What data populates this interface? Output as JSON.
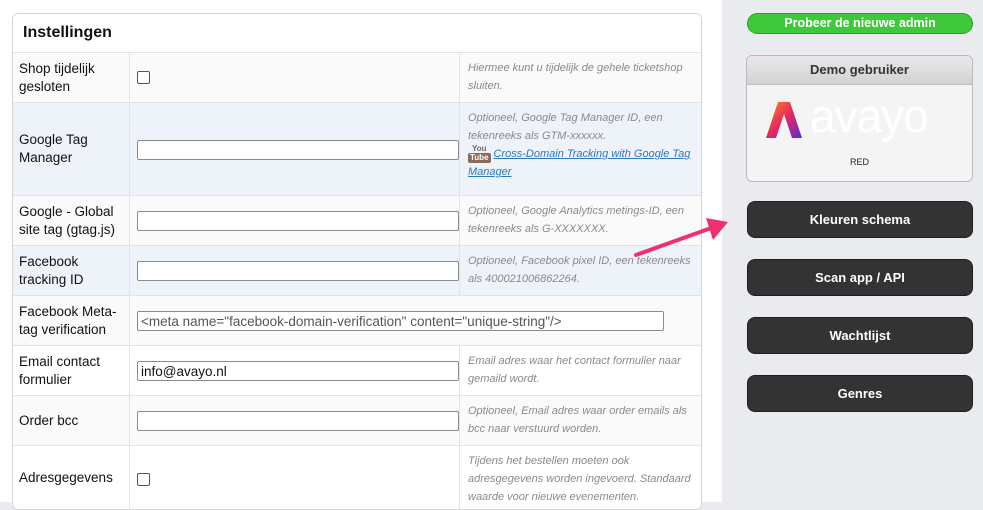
{
  "panel": {
    "title": "Instellingen",
    "rows": [
      {
        "label": "Shop tijdelijk gesloten",
        "type": "checkbox",
        "checked": false,
        "help": "Hiermee kunt u tijdelijk de gehele ticketshop sluiten."
      },
      {
        "label": "Google Tag Manager",
        "type": "text",
        "value": "",
        "placeholder": "",
        "help": "Optioneel, Google Tag Manager ID, een tekenreeks als GTM-xxxxxx.",
        "help_link": "Cross-Domain Tracking with Google Tag Manager",
        "help_icon": {
          "top": "You",
          "bottom": "Tube"
        }
      },
      {
        "label": "Google - Global site tag (gtag.js)",
        "type": "text",
        "value": "",
        "placeholder": "",
        "help": "Optioneel, Google Analytics metings-ID, een tekenreeks als G-XXXXXXX."
      },
      {
        "label": "Facebook tracking ID",
        "type": "text",
        "value": "",
        "placeholder": "",
        "help": "Optioneel, Facebook pixel ID, een tekenreeks als 400021006862264."
      },
      {
        "label": "Facebook Meta-tag verification",
        "type": "text-wide",
        "value": "",
        "placeholder": "<meta name=\"facebook-domain-verification\" content=\"unique-string\"/>",
        "help": ""
      },
      {
        "label": "Email contact formulier",
        "type": "text",
        "value": "info@avayo.nl",
        "placeholder": "",
        "help": "Email adres waar het contact formulier naar gemaild wordt."
      },
      {
        "label": "Order bcc",
        "type": "text",
        "value": "",
        "placeholder": "",
        "help": "Optioneel, Email adres waar order emails als bcc naar verstuurd worden."
      },
      {
        "label": "Adresgegevens",
        "type": "checkbox",
        "checked": false,
        "help": "Tijdens het bestellen moeten ook adresgegevens worden ingevoerd. Standaard waarde voor nieuwe evenementen."
      }
    ]
  },
  "sidebar": {
    "new_admin_label": "Probeer de nieuwe admin",
    "demo": {
      "title": "Demo gebruiker",
      "logo_text": "avayo",
      "caption": "RED"
    },
    "buttons": [
      "Kleuren schema",
      "Scan app / API",
      "Wachtlijst",
      "Genres"
    ]
  },
  "colors": {
    "new_admin_green": "#3fc93a",
    "dark_button": "#333333",
    "annotation_arrow": "#f0306e",
    "link_blue": "#2a7ab8",
    "logo_gradient": [
      "#ff5a1f",
      "#e5285f",
      "#6a2bd8"
    ]
  }
}
